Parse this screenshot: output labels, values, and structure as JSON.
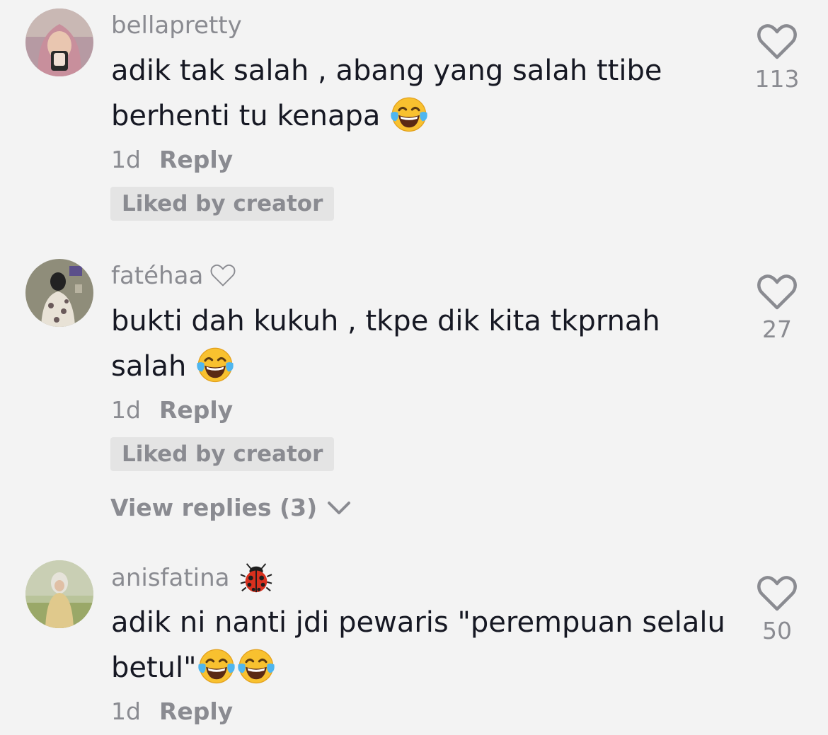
{
  "comments": [
    {
      "username": "bellapretty",
      "text": "adik tak salah , abang yang salah ttibe berhenti tu kenapa",
      "emojis": [
        "tears-of-joy"
      ],
      "time": "1d",
      "reply_label": "Reply",
      "liked_label": "Liked by creator",
      "like_count": "113"
    },
    {
      "username": "fatéhaa",
      "username_icon": "heart-outline",
      "text": "bukti dah kukuh , tkpe dik kita tkprnah salah",
      "emojis": [
        "tears-of-joy"
      ],
      "time": "1d",
      "reply_label": "Reply",
      "liked_label": "Liked by creator",
      "like_count": "27",
      "view_replies_label": "View replies (3)"
    },
    {
      "username": "anisfatina",
      "username_icon": "ladybug",
      "text": "adik ni nanti jdi pewaris \"perempuan selalu betul\"",
      "emojis": [
        "tears-of-joy",
        "tears-of-joy"
      ],
      "time": "1d",
      "reply_label": "Reply",
      "like_count": "50"
    }
  ],
  "colors": {
    "background": "#f3f3f3",
    "text": "#161823",
    "muted": "#8a8b91",
    "badge": "#e4e4e4"
  }
}
